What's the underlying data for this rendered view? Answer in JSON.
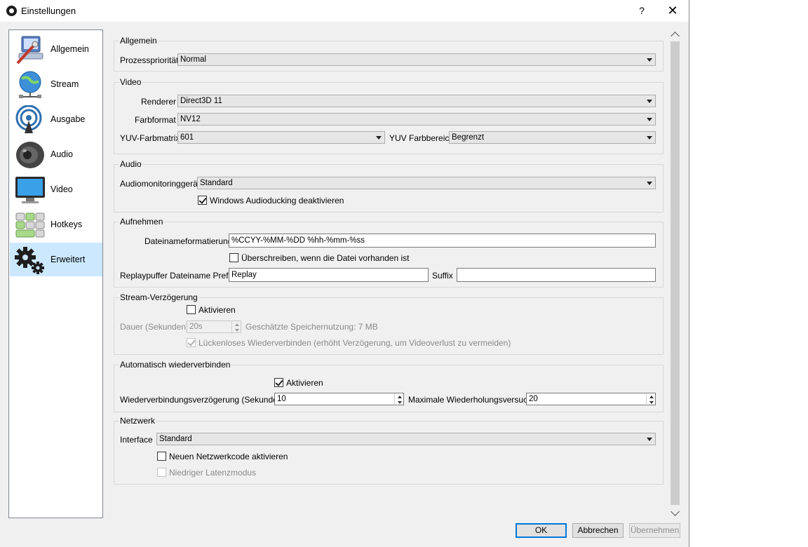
{
  "window": {
    "title": "Einstellungen",
    "help": "?",
    "close": "✕"
  },
  "sidebar": {
    "items": [
      {
        "label": "Allgemein",
        "icon": "general-settings-icon"
      },
      {
        "label": "Stream",
        "icon": "globe-network-icon"
      },
      {
        "label": "Ausgabe",
        "icon": "broadcast-output-icon"
      },
      {
        "label": "Audio",
        "icon": "speaker-icon"
      },
      {
        "label": "Video",
        "icon": "monitor-icon"
      },
      {
        "label": "Hotkeys",
        "icon": "keyboard-icon"
      },
      {
        "label": "Erweitert",
        "icon": "gears-icon",
        "selected": true
      }
    ]
  },
  "groups": {
    "allgemein": {
      "title": "Allgemein",
      "priority_label": "Prozesspriorität",
      "priority_value": "Normal"
    },
    "video": {
      "title": "Video",
      "renderer_label": "Renderer",
      "renderer_value": "Direct3D 11",
      "format_label": "Farbformat",
      "format_value": "NV12",
      "matrix_label": "YUV-Farbmatrix",
      "matrix_value": "601",
      "range_label": "YUV Farbbereich",
      "range_value": "Begrenzt"
    },
    "audio": {
      "title": "Audio",
      "monitor_label": "Audiomonitoringgerät",
      "monitor_value": "Standard",
      "ducking_label": "Windows Audioducking deaktivieren",
      "ducking_checked": true
    },
    "aufnehmen": {
      "title": "Aufnehmen",
      "filename_label": "Dateinameformatierung",
      "filename_value": "%CCYY-%MM-%DD %hh-%mm-%ss",
      "overwrite_label": "Überschreiben, wenn die Datei vorhanden ist",
      "overwrite_checked": false,
      "prefix_label": "Replaypuffer Dateiname Prefix",
      "prefix_value": "Replay",
      "suffix_label": "Suffix",
      "suffix_value": ""
    },
    "delay": {
      "title": "Stream-Verzögerung",
      "enable_label": "Aktivieren",
      "enable_checked": false,
      "duration_label": "Dauer (Sekunden)",
      "duration_value": "20s",
      "memory_label": "Geschätzte Speichernutzung: 7 MB",
      "seamless_label": "Lückenloses Wiederverbinden (erhöht Verzögerung, um Videoverlust zu vermeiden)",
      "seamless_checked": true
    },
    "reconnect": {
      "title": "Automatisch wiederverbinden",
      "enable_label": "Aktivieren",
      "enable_checked": true,
      "delay_label": "Wiederverbindungsverzögerung (Sekunden)",
      "delay_value": "10",
      "retries_label": "Maximale Wiederholungsversuche",
      "retries_value": "20"
    },
    "network": {
      "title": "Netzwerk",
      "interface_label": "Interface",
      "interface_value": "Standard",
      "newcode_label": "Neuen Netzwerkcode aktivieren",
      "newcode_checked": false,
      "lowlatency_label": "Niedriger Latenzmodus",
      "lowlatency_checked": false
    }
  },
  "buttons": {
    "ok": "OK",
    "cancel": "Abbrechen",
    "apply": "Übernehmen"
  },
  "colors": {
    "selection": "#cce8ff",
    "default_button_border": "#0078d7",
    "window_bg": "#f0f0f0"
  }
}
